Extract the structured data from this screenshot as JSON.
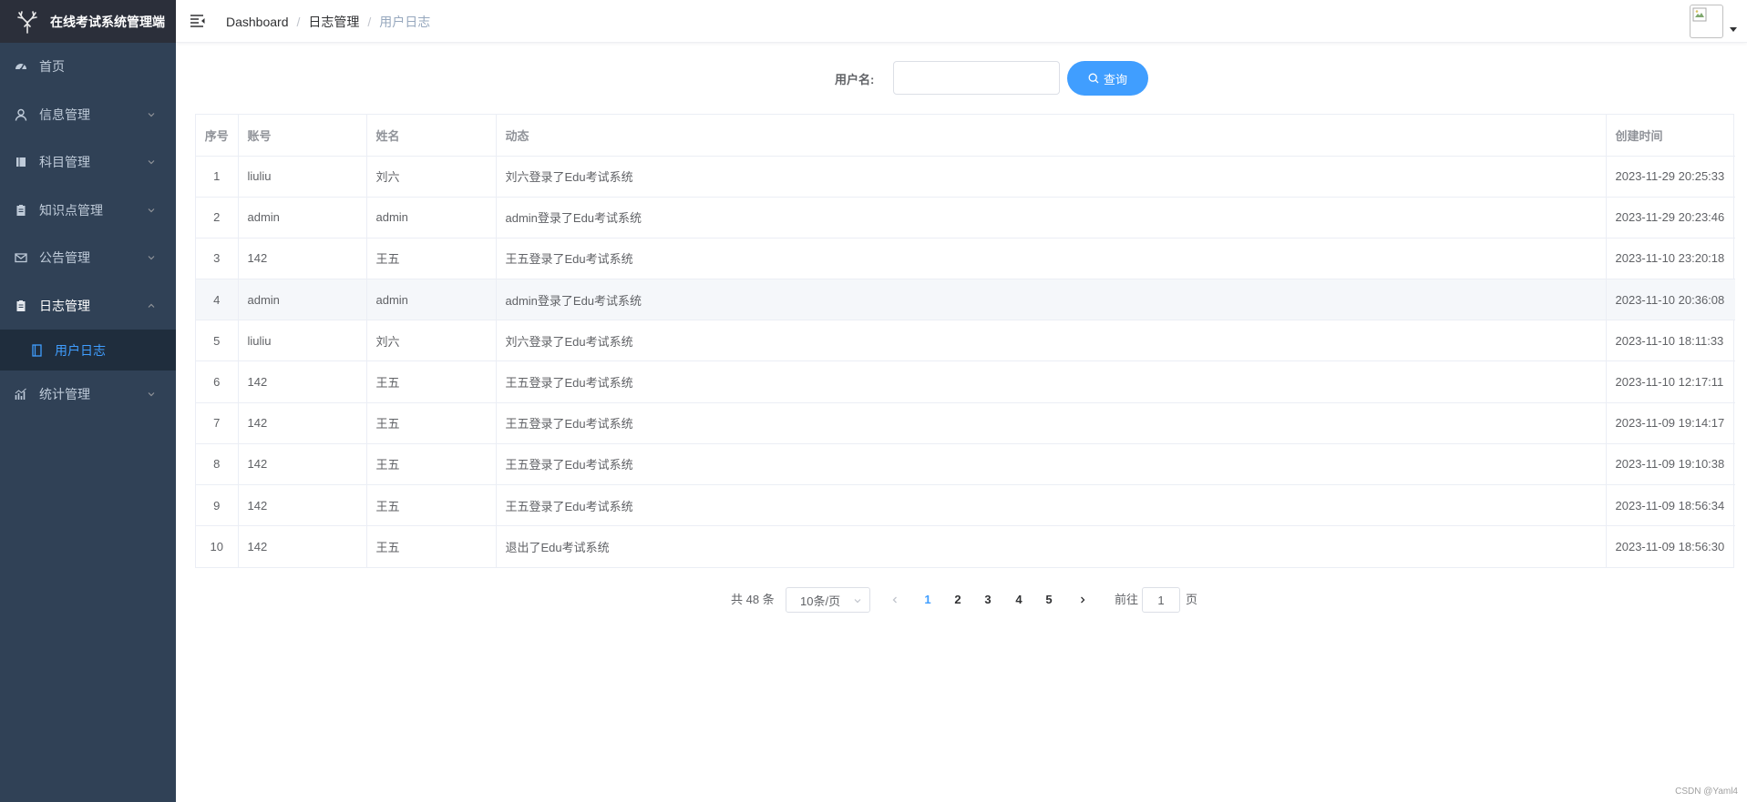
{
  "app": {
    "title": "在线考试系统管理端"
  },
  "sidebar": {
    "items": [
      {
        "label": "首页",
        "icon": "dashboard-icon"
      },
      {
        "label": "信息管理",
        "icon": "user-icon"
      },
      {
        "label": "科目管理",
        "icon": "book-icon"
      },
      {
        "label": "知识点管理",
        "icon": "clipboard-icon"
      },
      {
        "label": "公告管理",
        "icon": "mail-icon"
      },
      {
        "label": "日志管理",
        "icon": "clipboard-icon",
        "expanded": true
      },
      {
        "label": "统计管理",
        "icon": "chart-icon"
      }
    ],
    "submenu": {
      "label": "用户日志",
      "icon": "log-icon",
      "active": true
    }
  },
  "header": {
    "breadcrumb": [
      "Dashboard",
      "日志管理",
      "用户日志"
    ]
  },
  "search": {
    "label": "用户名:",
    "value": "",
    "placeholder": "",
    "button_label": "查询"
  },
  "table": {
    "columns": [
      "序号",
      "账号",
      "姓名",
      "动态",
      "创建时间"
    ],
    "rows": [
      [
        "1",
        "liuliu",
        "刘六",
        "刘六登录了Edu考试系统",
        "2023-11-29 20:25:33"
      ],
      [
        "2",
        "admin",
        "admin",
        "admin登录了Edu考试系统",
        "2023-11-29 20:23:46"
      ],
      [
        "3",
        "142",
        "王五",
        "王五登录了Edu考试系统",
        "2023-11-10 23:20:18"
      ],
      [
        "4",
        "admin",
        "admin",
        "admin登录了Edu考试系统",
        "2023-11-10 20:36:08"
      ],
      [
        "5",
        "liuliu",
        "刘六",
        "刘六登录了Edu考试系统",
        "2023-11-10 18:11:33"
      ],
      [
        "6",
        "142",
        "王五",
        "王五登录了Edu考试系统",
        "2023-11-10 12:17:11"
      ],
      [
        "7",
        "142",
        "王五",
        "王五登录了Edu考试系统",
        "2023-11-09 19:14:17"
      ],
      [
        "8",
        "142",
        "王五",
        "王五登录了Edu考试系统",
        "2023-11-09 19:10:38"
      ],
      [
        "9",
        "142",
        "王五",
        "王五登录了Edu考试系统",
        "2023-11-09 18:56:34"
      ],
      [
        "10",
        "142",
        "王五",
        "退出了Edu考试系统",
        "2023-11-09 18:56:30"
      ]
    ],
    "hover_row": 3
  },
  "pagination": {
    "total_text": "共 48 条",
    "page_size": "10条/页",
    "pages": [
      "1",
      "2",
      "3",
      "4",
      "5"
    ],
    "current_page": "1",
    "goto_label": "前往",
    "goto_value": "1",
    "goto_suffix": "页"
  },
  "watermark": "CSDN @Yaml4",
  "colors": {
    "sidebar_bg": "#304156",
    "logo_bg": "#2b2f3a",
    "submenu_bg": "#1f2d3d",
    "accent": "#409eff"
  }
}
